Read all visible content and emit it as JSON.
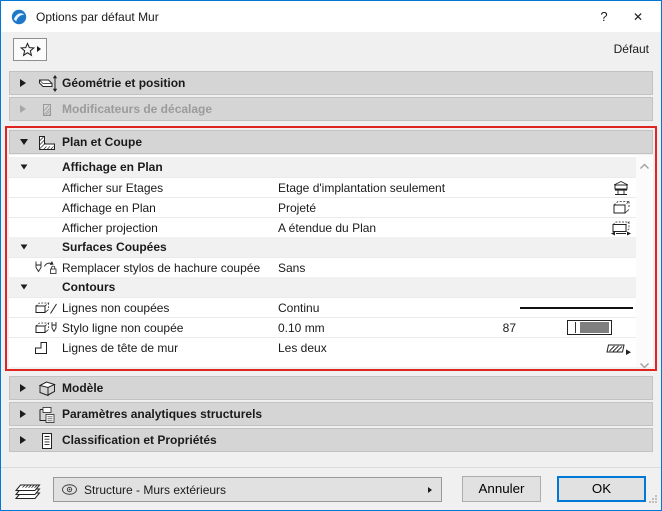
{
  "window": {
    "title": "Options par défaut Mur",
    "help_label": "?",
    "close_label": "✕"
  },
  "toolbar": {
    "default_label": "Défaut"
  },
  "accordions": [
    {
      "label": "Géométrie et position",
      "state": "collapsed",
      "disabled": false
    },
    {
      "label": "Modificateurs de décalage",
      "state": "collapsed",
      "disabled": true
    },
    {
      "label": "Plan et Coupe",
      "state": "expanded",
      "disabled": false
    },
    {
      "label": "Modèle",
      "state": "collapsed",
      "disabled": false
    },
    {
      "label": "Paramètres analytiques structurels",
      "state": "collapsed",
      "disabled": false
    },
    {
      "label": "Classification et Propriétés",
      "state": "collapsed",
      "disabled": false
    }
  ],
  "plan": {
    "groups": [
      {
        "label": "Affichage en Plan",
        "rows": [
          {
            "label": "Afficher sur Etages",
            "value": "Etage d'implantation seulement",
            "icon": "storey-display-icon"
          },
          {
            "label": "Affichage en Plan",
            "value": "Projeté",
            "icon": "projected-view-icon"
          },
          {
            "label": "Afficher projection",
            "value": "A étendue du Plan",
            "icon": "plan-range-icon"
          }
        ]
      },
      {
        "label": "Surfaces Coupées",
        "rows": [
          {
            "label": "Remplacer stylos de hachure coupée",
            "value": "Sans",
            "icon": "override-cut-fill-pen-icon"
          }
        ]
      },
      {
        "label": "Contours",
        "rows": [
          {
            "label": "Lignes non coupées",
            "value": "Continu",
            "icon": "uncut-line-type-icon",
            "preview": "solid-line"
          },
          {
            "label": "Stylo ligne non coupée",
            "value": "0.10 mm",
            "pen_number": "87",
            "icon": "uncut-line-pen-icon"
          },
          {
            "label": "Lignes de tête de mur",
            "value": "Les deux",
            "icon": "wall-end-lines-icon",
            "preview": "hatch-arrow"
          }
        ]
      }
    ]
  },
  "footer": {
    "layer_combo_value": "Structure - Murs extérieurs",
    "cancel_label": "Annuler",
    "ok_label": "OK"
  },
  "colors": {
    "window_border": "#0078d7",
    "annotation_red": "#e02420",
    "ok_focus_border": "#0078d7",
    "pen_87_color": "#7f7f7f"
  }
}
